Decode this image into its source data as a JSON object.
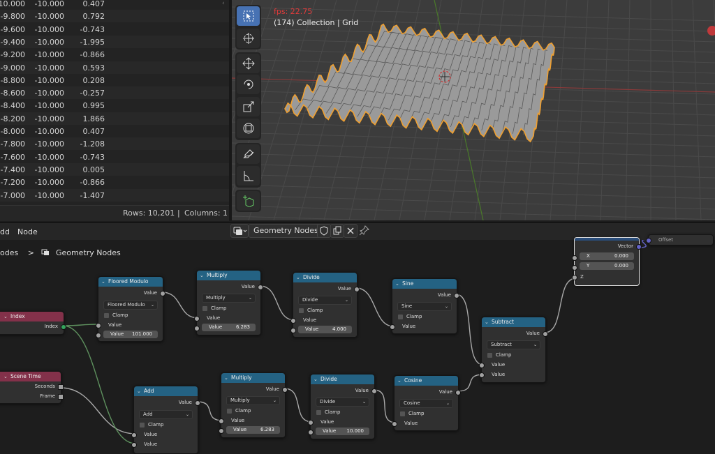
{
  "spreadsheet": {
    "rows": [
      [
        "-10.000",
        "-10.000",
        "0.407"
      ],
      [
        "-9.800",
        "-10.000",
        "0.792"
      ],
      [
        "-9.600",
        "-10.000",
        "-0.743"
      ],
      [
        "-9.400",
        "-10.000",
        "-1.995"
      ],
      [
        "-9.200",
        "-10.000",
        "-0.866"
      ],
      [
        "-9.000",
        "-10.000",
        "0.593"
      ],
      [
        "-8.800",
        "-10.000",
        "0.208"
      ],
      [
        "-8.600",
        "-10.000",
        "-0.257"
      ],
      [
        "-8.400",
        "-10.000",
        "0.995"
      ],
      [
        "-8.200",
        "-10.000",
        "1.866"
      ],
      [
        "-8.000",
        "-10.000",
        "0.407"
      ],
      [
        "-7.800",
        "-10.000",
        "-1.208"
      ],
      [
        "-7.600",
        "-10.000",
        "-0.743"
      ],
      [
        "-7.400",
        "-10.000",
        "0.005"
      ],
      [
        "-7.200",
        "-10.000",
        "-0.866"
      ],
      [
        "-7.000",
        "-10.000",
        "-1.407"
      ]
    ],
    "footer": {
      "rows": "Rows: 10,201",
      "separator": "|",
      "columns": "Columns: 1"
    }
  },
  "viewport": {
    "fps": "fps: 22.75",
    "collection": "(174) Collection | Grid",
    "tools": [
      "select-box",
      "cursor",
      "move",
      "rotate",
      "scale",
      "transform",
      "annotate",
      "measure",
      "add-cube"
    ]
  },
  "node_editor": {
    "menu": {
      "add": "dd",
      "node": "Node"
    },
    "tree_name": "Geometry Nodes",
    "breadcrumb": {
      "parent": "odes",
      "sep": ">",
      "current": "Geometry Nodes"
    },
    "nodes": {
      "index": {
        "title": "Index",
        "out": "Index"
      },
      "scene_time": {
        "title": "Scene Time",
        "out1": "Seconds",
        "out2": "Frame"
      },
      "floored_modulo": {
        "title": "Floored Modulo",
        "out": "Value",
        "op": "Floored Modulo",
        "clamp": "Clamp",
        "in1": "Value",
        "field_label": "Value",
        "field_value": "101.000"
      },
      "multiply1": {
        "title": "Multiply",
        "out": "Value",
        "op": "Multiply",
        "clamp": "Clamp",
        "in1": "Value",
        "field_label": "Value",
        "field_value": "6.283"
      },
      "divide1": {
        "title": "Divide",
        "out": "Value",
        "op": "Divide",
        "clamp": "Clamp",
        "in1": "Value",
        "field_label": "Value",
        "field_value": "4.000"
      },
      "sine": {
        "title": "Sine",
        "out": "Value",
        "op": "Sine",
        "clamp": "Clamp",
        "in1": "Value"
      },
      "subtract": {
        "title": "Subtract",
        "out": "Value",
        "op": "Subtract",
        "clamp": "Clamp",
        "in1": "Value",
        "in2": "Value"
      },
      "combine": {
        "out": "Vector",
        "x_label": "X",
        "x_value": "0.000",
        "y_label": "Y",
        "y_value": "0.000",
        "z_label": "Z",
        "offset": "Offset"
      },
      "add": {
        "title": "Add",
        "out": "Value",
        "op": "Add",
        "clamp": "Clamp",
        "in1": "Value",
        "in2": "Value"
      },
      "multiply2": {
        "title": "Multiply",
        "out": "Value",
        "op": "Multiply",
        "clamp": "Clamp",
        "in1": "Value",
        "field_label": "Value",
        "field_value": "6.283"
      },
      "divide2": {
        "title": "Divide",
        "out": "Value",
        "op": "Divide",
        "clamp": "Clamp",
        "in1": "Value",
        "field_label": "Value",
        "field_value": "10.000"
      },
      "cosine": {
        "title": "Cosine",
        "out": "Value",
        "op": "Cosine",
        "clamp": "Clamp",
        "in1": "Value"
      }
    }
  },
  "colors": {
    "math_header": "#246283",
    "input_header": "#83314a",
    "selection": "#f0a030",
    "active_tool": "#4772b3"
  }
}
